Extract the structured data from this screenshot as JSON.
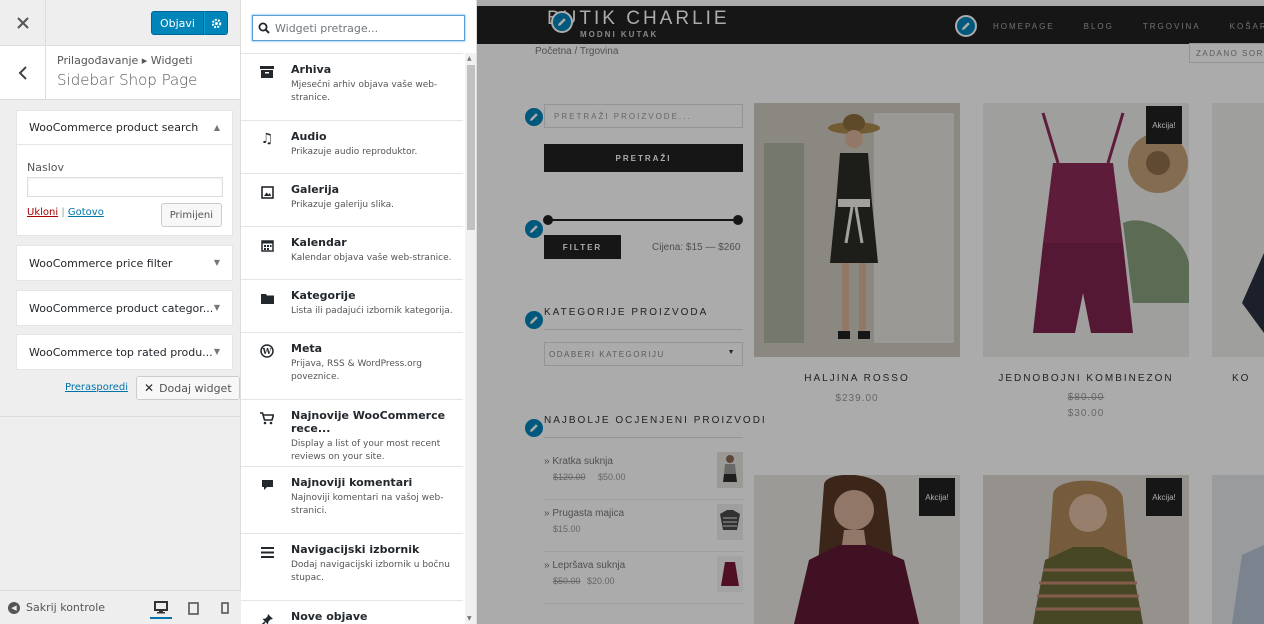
{
  "panel": {
    "publish_label": "Objavi",
    "breadcrumb": "Prilagođavanje ▸ Widgeti",
    "section_title": "Sidebar Shop Page",
    "widgets": [
      {
        "title": "WooCommerce product search"
      },
      {
        "title": "WooCommerce price filter"
      },
      {
        "title": "WooCommerce product categor..."
      },
      {
        "title": "WooCommerce top rated produ..."
      }
    ],
    "field_label": "Naslov",
    "field_value": "",
    "remove_label": "Ukloni",
    "separator": "|",
    "done_label": "Gotovo",
    "apply_label": "Primijeni",
    "reorder_label": "Prerasporedi",
    "add_widget_label": "Dodaj widget",
    "hide_controls_label": "Sakrij kontrole"
  },
  "available": {
    "search_placeholder": "Widgeti pretrage...",
    "items": [
      {
        "icon": "archive-icon",
        "title": "Arhiva",
        "desc": "Mjesečni arhiv objava vaše web-stranice."
      },
      {
        "icon": "music-icon",
        "title": "Audio",
        "desc": "Prikazuje audio reproduktor."
      },
      {
        "icon": "gallery-icon",
        "title": "Galerija",
        "desc": "Prikazuje galeriju slika."
      },
      {
        "icon": "calendar-icon",
        "title": "Kalendar",
        "desc": "Kalendar objava vaše web-stranice."
      },
      {
        "icon": "folder-icon",
        "title": "Kategorije",
        "desc": "Lista ili padajući izbornik kategorija."
      },
      {
        "icon": "wordpress-icon",
        "title": "Meta",
        "desc": "Prijava, RSS & WordPress.org poveznice."
      },
      {
        "icon": "cart-icon",
        "title": "Najnovije WooCommerce rece...",
        "desc": "Display a list of your most recent reviews on your site."
      },
      {
        "icon": "comment-icon",
        "title": "Najnoviji komentari",
        "desc": "Najnoviji komentari na vašoj web-stranici."
      },
      {
        "icon": "menu-icon",
        "title": "Navigacijski izbornik",
        "desc": "Dodaj navigacijski izbornik u bočnu stupac."
      },
      {
        "icon": "pin-icon",
        "title": "Nove objave",
        "desc": ""
      }
    ]
  },
  "site": {
    "logo": "BUTIK CHARLIE",
    "tagline": "MODNI KUTAK",
    "nav": [
      "HOMEPAGE",
      "BLOG",
      "TRGOVINA",
      "KOŠARICA"
    ],
    "breadcrumb": "Početna / Trgovina",
    "sort": "ZADANO SORTIRANJE",
    "search_placeholder": "PRETRAŽI PROIZVODE...",
    "search_button": "PRETRAŽI",
    "filter_button": "FILTER",
    "price_range": "Cijena: $15 — $260",
    "categories_title": "KATEGORIJE PROIZVODA",
    "categories_select": "ODABERI KATEGORIJU",
    "top_rated_title": "NAJBOLJE OCJENJENI PROIZVODI",
    "top_rated": [
      {
        "name": "» Kratka suknja",
        "old": "$120.00",
        "price": "$50.00"
      },
      {
        "name": "» Prugasta majica",
        "old": "",
        "price": "$15.00"
      },
      {
        "name": "» Lepršava suknja",
        "old": "$50.00",
        "price": "$20.00"
      }
    ],
    "sale_label": "Akcija!",
    "products": [
      {
        "name": "HALJINA ROSSO",
        "old": "",
        "price": "$239.00"
      },
      {
        "name": "JEDNOBOJNI KOMBINEZON",
        "old": "$80.00",
        "price": "$30.00"
      },
      {
        "name": "KO",
        "old": "",
        "price": ""
      }
    ]
  },
  "colors": {
    "accent": "#0085ba",
    "dark": "#222222",
    "sale": "#222222"
  }
}
